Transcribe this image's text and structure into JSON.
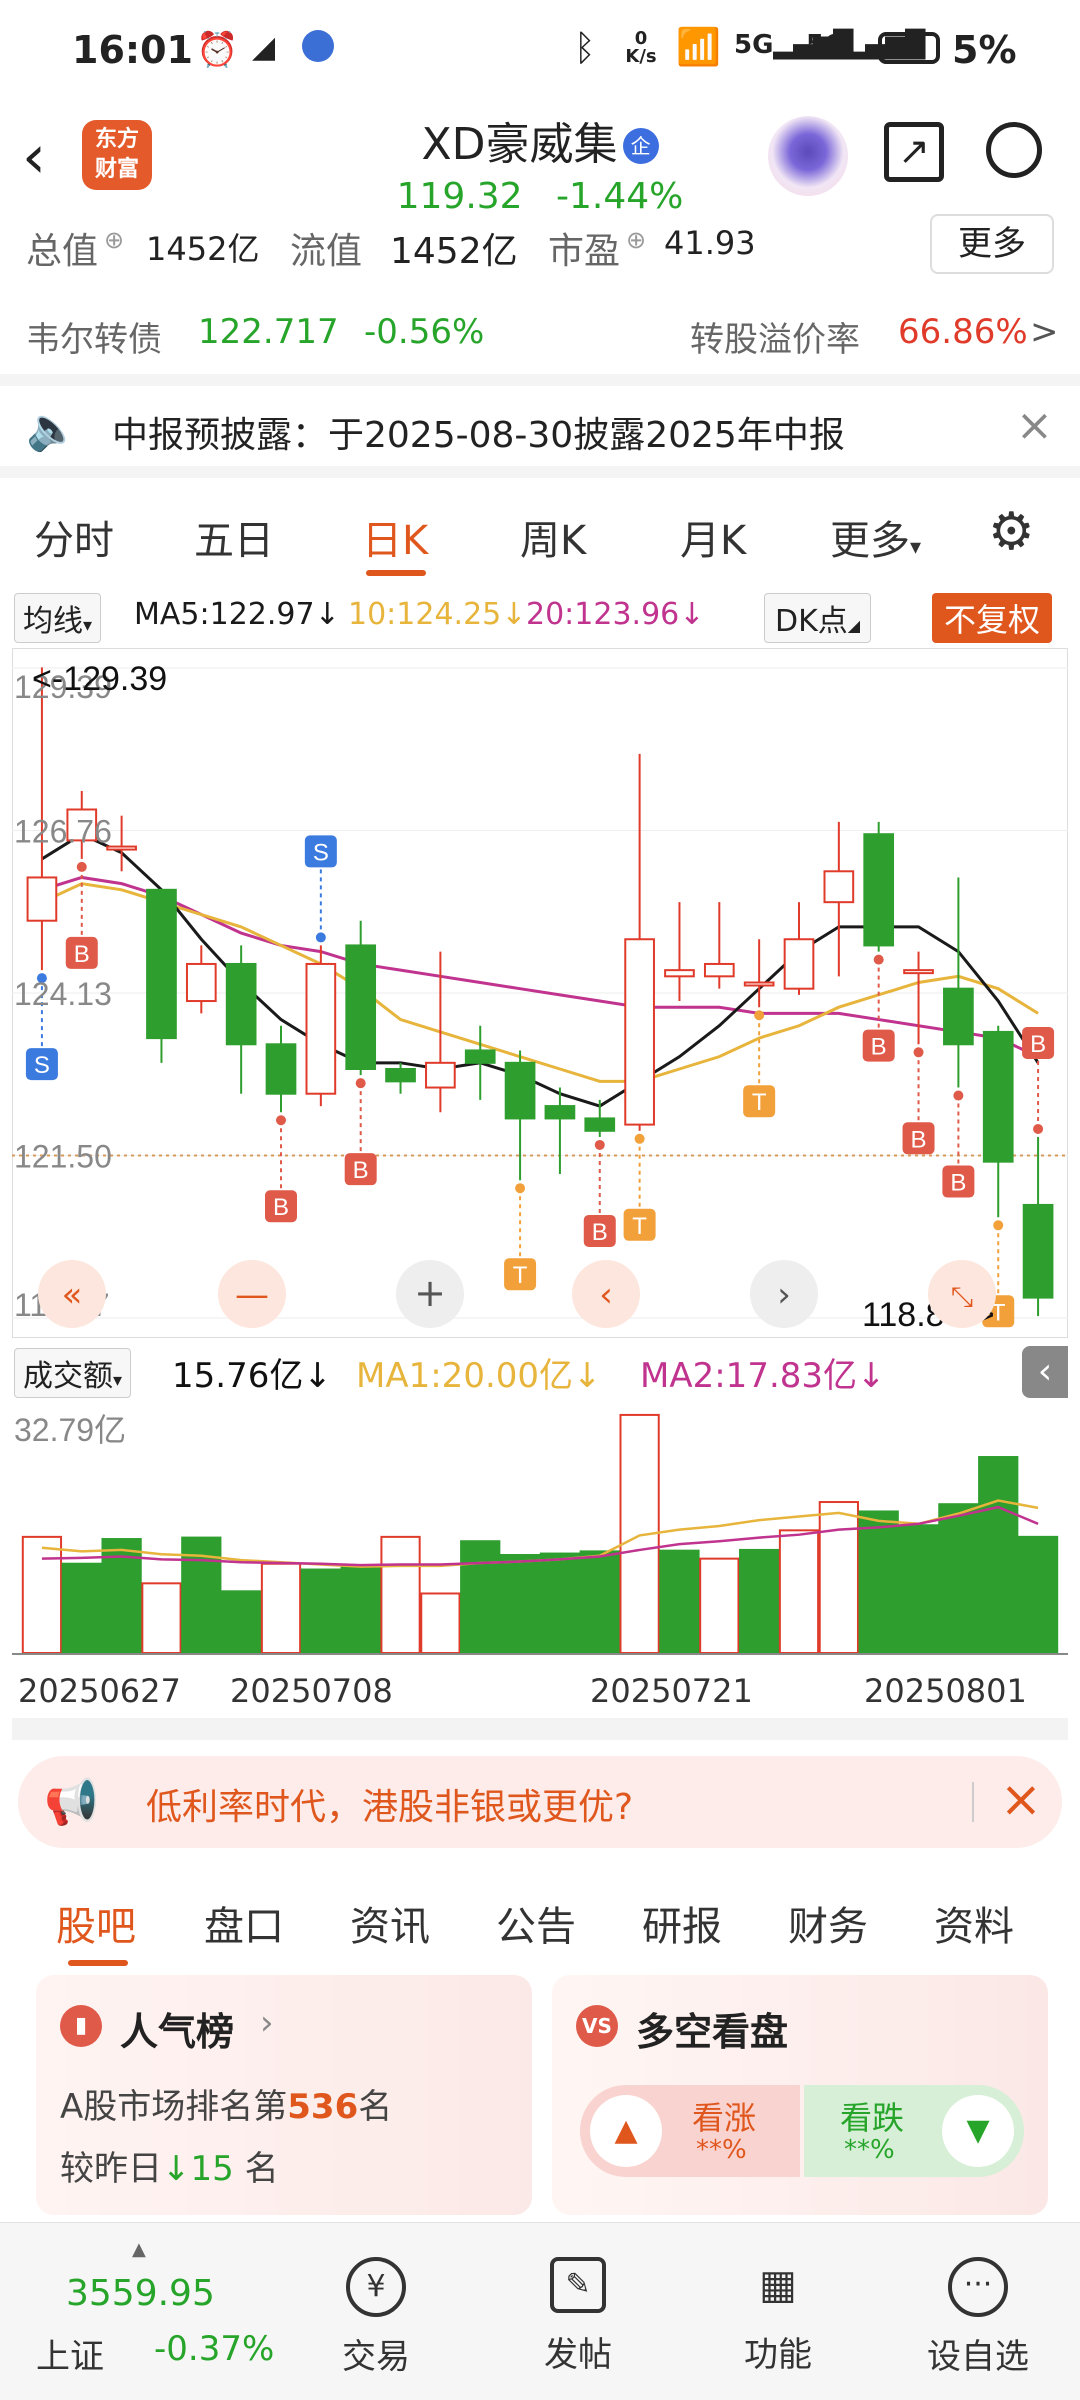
{
  "status_bar": {
    "time": "16:01",
    "net_speed": "0 K/s",
    "battery": "5%"
  },
  "header": {
    "logo_line1": "东方",
    "logo_line2": "财富",
    "title": "XD豪威集",
    "badge": "企",
    "price": "119.32",
    "change": "-1.44%"
  },
  "quote_strip": {
    "total_label": "总值",
    "total_value": "1452亿",
    "float_label": "流值",
    "float_value": "1452亿",
    "pe_label": "市盈",
    "pe_value": "41.93",
    "more": "更多"
  },
  "bond": {
    "name": "韦尔转债",
    "price": "122.717",
    "change": "-0.56%",
    "premium_label": "转股溢价率",
    "premium_value": "66.86%",
    "arrow": ">"
  },
  "notice": {
    "text": "中报预披露：于2025-08-30披露2025年中报"
  },
  "period_tabs": [
    "分时",
    "五日",
    "日K",
    "周K",
    "月K",
    "更多"
  ],
  "active_period": "日K",
  "ma_row": {
    "selector": "均线",
    "ma5": "MA5:122.97",
    "ma10": "10:124.25",
    "ma20": "20:123.96",
    "dk": "DK点",
    "fq": "不复权"
  },
  "chart_data": {
    "type": "candlestick",
    "y_ticks": [
      "129.39",
      "126.76",
      "124.13",
      "121.50",
      "118.87"
    ],
    "ylim": [
      118.87,
      129.39
    ],
    "ref_price": 121.5,
    "high_label": "<-129.39",
    "low_label": "118.87->",
    "candles": [
      {
        "o": 125.3,
        "c": 126.0,
        "h": 129.4,
        "l": 124.5
      },
      {
        "o": 126.6,
        "c": 127.1,
        "h": 127.4,
        "l": 126.3
      },
      {
        "o": 126.5,
        "c": 126.5,
        "h": 127.0,
        "l": 126.1
      },
      {
        "o": 125.8,
        "c": 123.4,
        "h": 125.8,
        "l": 123.0
      },
      {
        "o": 124.0,
        "c": 124.6,
        "h": 124.9,
        "l": 123.8
      },
      {
        "o": 124.6,
        "c": 123.3,
        "h": 124.9,
        "l": 122.5
      },
      {
        "o": 123.3,
        "c": 122.5,
        "h": 123.6,
        "l": 122.2
      },
      {
        "o": 122.5,
        "c": 124.6,
        "h": 124.9,
        "l": 122.3
      },
      {
        "o": 124.9,
        "c": 122.9,
        "h": 125.3,
        "l": 122.8
      },
      {
        "o": 122.9,
        "c": 122.7,
        "h": 123.0,
        "l": 122.5
      },
      {
        "o": 122.6,
        "c": 123.0,
        "h": 124.8,
        "l": 122.2
      },
      {
        "o": 123.2,
        "c": 123.0,
        "h": 123.6,
        "l": 122.4
      },
      {
        "o": 123.0,
        "c": 122.1,
        "h": 123.2,
        "l": 121.1
      },
      {
        "o": 122.3,
        "c": 122.1,
        "h": 122.6,
        "l": 121.2
      },
      {
        "o": 122.1,
        "c": 121.9,
        "h": 122.4,
        "l": 121.8
      },
      {
        "o": 122.0,
        "c": 125.0,
        "h": 128.0,
        "l": 121.9
      },
      {
        "o": 124.4,
        "c": 124.5,
        "h": 125.6,
        "l": 124.0
      },
      {
        "o": 124.4,
        "c": 124.6,
        "h": 125.6,
        "l": 124.2
      },
      {
        "o": 124.3,
        "c": 124.3,
        "h": 125.0,
        "l": 123.9
      },
      {
        "o": 124.2,
        "c": 125.0,
        "h": 125.6,
        "l": 124.1
      },
      {
        "o": 125.6,
        "c": 126.1,
        "h": 126.9,
        "l": 124.4
      },
      {
        "o": 126.7,
        "c": 124.9,
        "h": 126.9,
        "l": 124.8
      },
      {
        "o": 124.5,
        "c": 124.5,
        "h": 124.8,
        "l": 123.3
      },
      {
        "o": 124.2,
        "c": 123.3,
        "h": 126.0,
        "l": 122.6
      },
      {
        "o": 123.5,
        "c": 121.4,
        "h": 123.6,
        "l": 120.5
      },
      {
        "o": 120.7,
        "c": 119.2,
        "h": 121.8,
        "l": 118.9
      }
    ],
    "ma5": [
      126.3,
      126.7,
      126.4,
      125.8,
      125.0,
      124.3,
      123.7,
      123.3,
      123.0,
      123.0,
      122.9,
      123.0,
      122.8,
      122.5,
      122.3,
      122.7,
      123.1,
      123.6,
      124.2,
      124.8,
      125.2,
      125.2,
      125.2,
      124.8,
      124.0,
      123.0
    ],
    "ma10": [
      125.6,
      125.9,
      125.8,
      125.6,
      125.4,
      125.2,
      124.9,
      124.6,
      124.2,
      123.7,
      123.5,
      123.3,
      123.1,
      122.9,
      122.7,
      122.7,
      122.9,
      123.1,
      123.4,
      123.6,
      123.9,
      124.1,
      124.3,
      124.4,
      124.2,
      123.8
    ],
    "ma20": [
      125.8,
      126.0,
      125.9,
      125.7,
      125.4,
      125.1,
      124.9,
      124.8,
      124.6,
      124.5,
      124.4,
      124.3,
      124.2,
      124.1,
      124.0,
      123.9,
      123.9,
      123.9,
      123.8,
      123.8,
      123.8,
      123.7,
      123.6,
      123.5,
      123.4,
      123.1
    ],
    "markers": [
      {
        "i": 0,
        "type": "S",
        "pos": "below"
      },
      {
        "i": 1,
        "type": "B",
        "pos": "below"
      },
      {
        "i": 6,
        "type": "B",
        "pos": "below"
      },
      {
        "i": 7,
        "type": "S",
        "pos": "above"
      },
      {
        "i": 8,
        "type": "B",
        "pos": "below"
      },
      {
        "i": 12,
        "type": "T",
        "pos": "below"
      },
      {
        "i": 14,
        "type": "B",
        "pos": "below"
      },
      {
        "i": 15,
        "type": "T",
        "pos": "below"
      },
      {
        "i": 18,
        "type": "T",
        "pos": "below"
      },
      {
        "i": 21,
        "type": "B",
        "pos": "below"
      },
      {
        "i": 22,
        "type": "B",
        "pos": "below"
      },
      {
        "i": 23,
        "type": "B",
        "pos": "below"
      },
      {
        "i": 24,
        "type": "T",
        "pos": "below"
      },
      {
        "i": 25,
        "type": "B",
        "pos": "above"
      }
    ],
    "volume": {
      "ylim": [
        0,
        32.79
      ],
      "top_label": "32.79亿",
      "values": [
        16.0,
        12.3,
        15.7,
        9.6,
        15.9,
        8.5,
        12.3,
        11.5,
        12.0,
        16.0,
        8.2,
        15.4,
        13.5,
        13.7,
        14.0,
        32.8,
        14.1,
        13.0,
        14.2,
        16.9,
        20.8,
        19.5,
        17.6,
        20.5,
        27.0,
        16.0
      ],
      "up": [
        true,
        false,
        false,
        true,
        false,
        false,
        true,
        false,
        false,
        true,
        true,
        false,
        false,
        false,
        false,
        true,
        false,
        true,
        false,
        true,
        true,
        false,
        false,
        false,
        false,
        false
      ],
      "ma1": [
        14.5,
        14.0,
        14.2,
        13.6,
        13.4,
        12.8,
        12.5,
        12.2,
        11.9,
        12.0,
        12.0,
        12.4,
        12.6,
        12.9,
        13.4,
        16.2,
        17.0,
        17.5,
        18.3,
        18.8,
        19.3,
        18.2,
        17.8,
        19.2,
        21.0,
        20.0
      ],
      "ma2": [
        13.0,
        13.1,
        13.3,
        12.9,
        12.8,
        12.5,
        12.4,
        12.3,
        12.1,
        12.2,
        12.2,
        12.4,
        12.6,
        12.9,
        13.3,
        14.2,
        15.0,
        15.4,
        15.9,
        16.3,
        17.0,
        17.3,
        17.8,
        18.9,
        20.1,
        17.8
      ]
    },
    "x_ticks": [
      "20250627",
      "20250708",
      "20250721",
      "20250801"
    ]
  },
  "volume_header": {
    "selector": "成交额",
    "value": "15.76亿",
    "ma1": "MA1:20.00亿",
    "ma2": "MA2:17.83亿"
  },
  "ad": {
    "text": "低利率时代，港股非银或更优?"
  },
  "info_tabs": [
    "股吧",
    "盘口",
    "资讯",
    "公告",
    "研报",
    "财务",
    "资料"
  ],
  "active_info_tab": "股吧",
  "popularity": {
    "title": "人气榜",
    "rank_prefix": "A股市场排名第",
    "rank": "536",
    "rank_suffix": "名",
    "vs_prefix": "较昨日",
    "vs_value": "15",
    "vs_suffix": "名"
  },
  "long_short": {
    "title": "多空看盘",
    "up_label": "看涨",
    "up_value": "**%",
    "down_label": "看跌",
    "down_value": "**%"
  },
  "bottom_bar": {
    "index_value": "3559.95",
    "index_name": "上证",
    "index_change": "-0.37%",
    "buttons": [
      "交易",
      "发帖",
      "功能",
      "设自选"
    ]
  },
  "colors": {
    "up": "#e03b2a",
    "down": "#2e9e2e",
    "ma5": "#1a1a1a",
    "ma10": "#e7b43c",
    "ma20": "#c0338e",
    "accent": "#e0571e"
  }
}
